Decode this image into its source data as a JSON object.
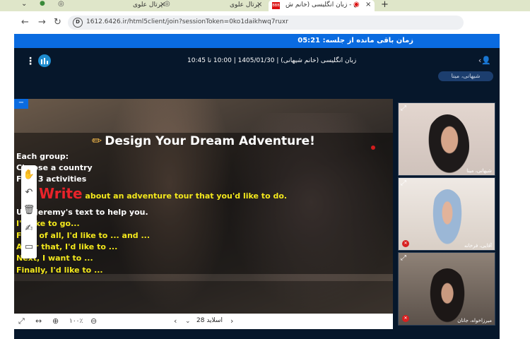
{
  "browser": {
    "tabs": [
      {
        "title": "پرتال علوی",
        "active": false
      },
      {
        "title": "پرتال علوی",
        "active": false
      },
      {
        "title": "علوی - زبان انگلیسی (خانم ش...",
        "active": true
      }
    ],
    "url": "1612.6426.ir/html5client/join?sessionToken=0ko1daikhwq7ruxr"
  },
  "session": {
    "remaining_label": "زمان باقی مانده از جلسه:",
    "remaining_time": "05:21"
  },
  "meeting": {
    "title": "زبان انگلیسی (خانم شیهانی) | 1405/01/30 | 10:00 تا 10:45",
    "presenter": "شیهانی، مینا"
  },
  "slide": {
    "title": "Design Your Dream Adventure!",
    "lines": [
      {
        "text": "Each group:",
        "color": "white"
      },
      {
        "text": "Choose a country",
        "color": "white"
      },
      {
        "text": "Find 3 activities",
        "color": "white"
      },
      {
        "text": "Use Jeremy's text to help you.",
        "color": "white"
      },
      {
        "text": "I'd like to go...",
        "color": "yellow"
      },
      {
        "text": "First of all, I'd like to ... and ...",
        "color": "yellow"
      },
      {
        "text": "After that, I'd like to ...",
        "color": "yellow"
      },
      {
        "text": "Next, I want to ...",
        "color": "yellow"
      },
      {
        "text": "Finally, I'd like to ...",
        "color": "yellow"
      }
    ],
    "write_word": "Write",
    "write_rest": "about an adventure tour that you'd like to do."
  },
  "controls": {
    "zoom": "۱۰۰٪",
    "slide_label": "اسلاید 28"
  },
  "webcams": [
    {
      "name": "شیهانی، مینا"
    },
    {
      "name": "آقایی، فرخانه"
    },
    {
      "name": "میرزاخواه، جانان"
    }
  ],
  "colors": {
    "session_bar": "#0a6be0",
    "app_bg": "#06172b",
    "accent_red": "#e8232a",
    "accent_yellow": "#f3e81c"
  }
}
